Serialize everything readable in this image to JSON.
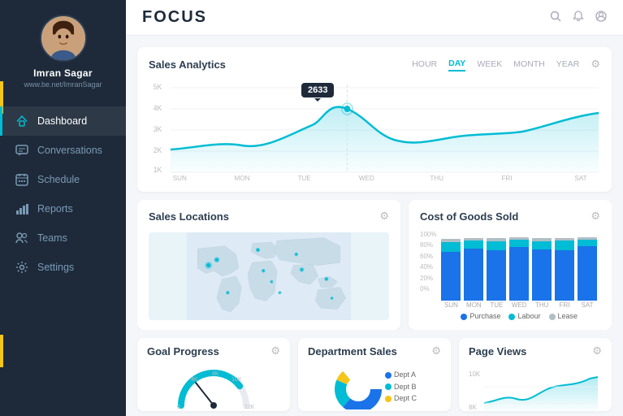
{
  "sidebar": {
    "user": {
      "name": "Imran Sagar",
      "url": "www.be.net/ImranSagar"
    },
    "nav": [
      {
        "id": "dashboard",
        "label": "Dashboard",
        "icon": "⚡",
        "active": true
      },
      {
        "id": "conversations",
        "label": "Conversations",
        "icon": "💬",
        "active": false
      },
      {
        "id": "schedule",
        "label": "Schedule",
        "icon": "📅",
        "active": false
      },
      {
        "id": "reports",
        "label": "Reports",
        "icon": "📊",
        "active": false
      },
      {
        "id": "teams",
        "label": "Teams",
        "icon": "👥",
        "active": false
      },
      {
        "id": "settings",
        "label": "Settings",
        "icon": "⚙",
        "active": false
      }
    ]
  },
  "header": {
    "logo": "FOCUS",
    "icons": [
      "🔍",
      "🔔",
      "⊙"
    ]
  },
  "analytics": {
    "title": "Sales Analytics",
    "time_tabs": [
      "HOUR",
      "DAY",
      "WEEK",
      "MONTH",
      "YEAR"
    ],
    "active_tab": "DAY",
    "tooltip_value": "2633",
    "x_labels": [
      "SUN",
      "MON",
      "TUE",
      "WED",
      "THU",
      "FRI",
      "SAT"
    ],
    "y_labels": [
      "5K",
      "4K",
      "3K",
      "2K",
      "1K"
    ]
  },
  "sales_locations": {
    "title": "Sales Locations"
  },
  "cost_of_goods": {
    "title": "Cost of Goods Sold",
    "y_labels": [
      "100%",
      "80%",
      "60%",
      "40%",
      "20%",
      "0%"
    ],
    "x_labels": [
      "SUN",
      "MON",
      "TUE",
      "WED",
      "THU",
      "FRI",
      "SAT"
    ],
    "legend": [
      {
        "label": "Purchase",
        "color": "#1a73e8"
      },
      {
        "label": "Labour",
        "color": "#00bcd4"
      },
      {
        "label": "Lease",
        "color": "#b0bec5"
      }
    ],
    "bars": [
      {
        "purchase": 75,
        "labour": 15,
        "lease": 5
      },
      {
        "purchase": 80,
        "labour": 12,
        "lease": 4
      },
      {
        "purchase": 78,
        "labour": 14,
        "lease": 5
      },
      {
        "purchase": 82,
        "labour": 11,
        "lease": 4
      },
      {
        "purchase": 79,
        "labour": 13,
        "lease": 5
      },
      {
        "purchase": 77,
        "labour": 15,
        "lease": 4
      },
      {
        "purchase": 83,
        "labour": 10,
        "lease": 4
      }
    ]
  },
  "goal_progress": {
    "title": "Goal Progress"
  },
  "department_sales": {
    "title": "Department Sales"
  },
  "page_views": {
    "title": "Page Views",
    "y_labels": [
      "10K",
      "8K"
    ]
  }
}
